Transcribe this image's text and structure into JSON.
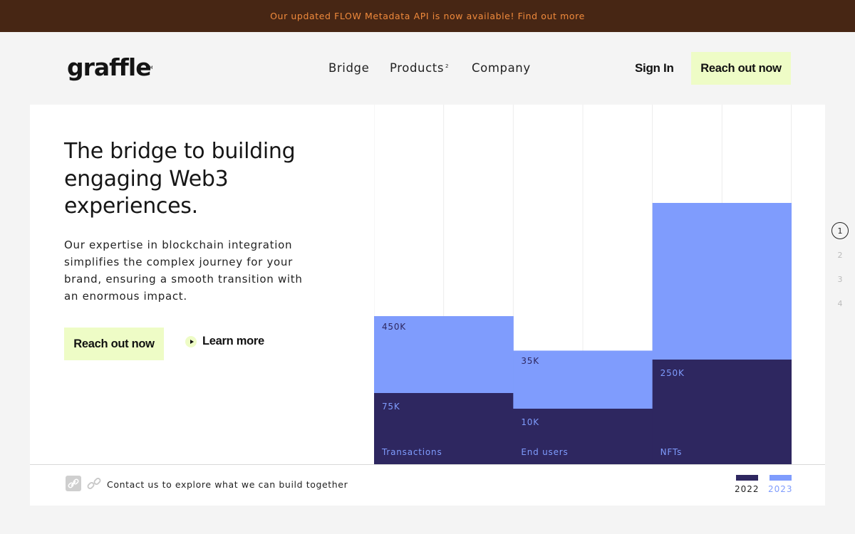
{
  "banner": {
    "text": "Our updated FLOW Metadata API is now available! Find out more"
  },
  "header": {
    "logo": "graffle",
    "logo_tm": "TM",
    "nav": [
      {
        "label": "Bridge",
        "sup": ""
      },
      {
        "label": "Products",
        "sup": "2"
      },
      {
        "label": "Company",
        "sup": ""
      }
    ],
    "signin": "Sign In",
    "cta": "Reach out now"
  },
  "hero": {
    "headline": "The bridge to building engaging Web3 experiences.",
    "description": "Our expertise in blockchain integration simplifies the complex journey for your brand, ensuring a smooth transition with an enormous impact.",
    "cta": "Reach out now",
    "learn_more": "Learn more"
  },
  "footer": {
    "contact_text": "Contact us to explore what we can build together"
  },
  "pager": [
    "1",
    "2",
    "3",
    "4"
  ],
  "colors": {
    "series_2022": "#2e2760",
    "series_2023": "#7f9cfd",
    "cta_bg": "#eefcc6",
    "banner_bg": "#472614",
    "banner_text": "#f08a3c"
  },
  "chart_data": {
    "type": "bar",
    "categories": [
      "Transactions",
      "End users",
      "NFTs"
    ],
    "series": [
      {
        "name": "2022",
        "labels": [
          "75K",
          "10K",
          "250K"
        ],
        "values": [
          75000,
          10000,
          250000
        ]
      },
      {
        "name": "2023",
        "labels": [
          "450K",
          "35K",
          ""
        ],
        "values": [
          450000,
          35000,
          null
        ]
      }
    ],
    "legend": [
      "2022",
      "2023"
    ],
    "legend_position": "bottom-right"
  }
}
